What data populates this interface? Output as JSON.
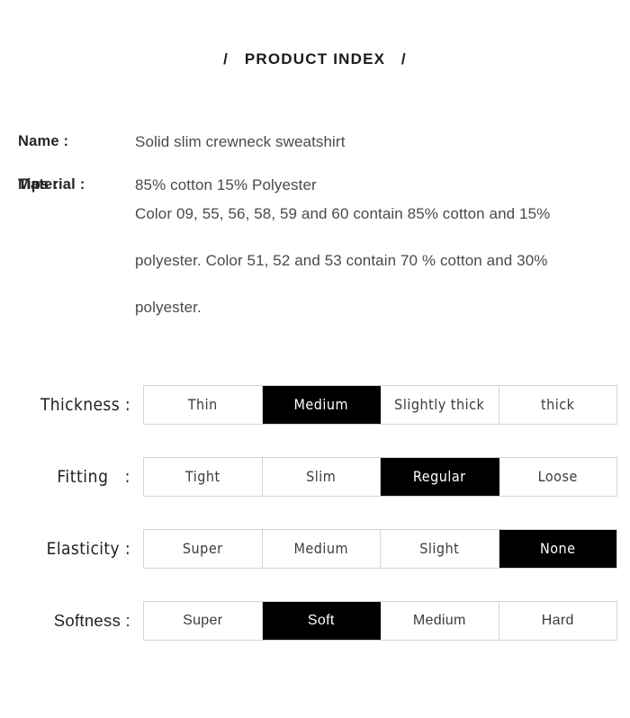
{
  "header": {
    "title": "/   PRODUCT INDEX   /"
  },
  "spec": {
    "rows": [
      {
        "label": "Name :",
        "value": "Solid slim crewneck sweatshirt"
      },
      {
        "label": "Material :",
        "value": "85% cotton 15% Polyester"
      },
      {
        "label": "Tips :",
        "value": "Color 09, 55, 56, 58, 59 and 60 contain 85% cotton and 15% polyester. Color 51, 52 and 53 contain 70 % cotton and 30% polyester."
      }
    ]
  },
  "attributes": {
    "rows": [
      {
        "label": "Thickness :",
        "options": [
          {
            "label": "Thin",
            "selected": false
          },
          {
            "label": "Medium",
            "selected": true
          },
          {
            "label": "Slightly thick",
            "selected": false
          },
          {
            "label": "thick",
            "selected": false
          }
        ]
      },
      {
        "label": "Fitting   :",
        "options": [
          {
            "label": "Tight",
            "selected": false
          },
          {
            "label": "Slim",
            "selected": false
          },
          {
            "label": "Regular",
            "selected": true
          },
          {
            "label": "Loose",
            "selected": false
          }
        ]
      },
      {
        "label": "Elasticity :",
        "options": [
          {
            "label": "Super",
            "selected": false
          },
          {
            "label": "Medium",
            "selected": false
          },
          {
            "label": "Slight",
            "selected": false
          },
          {
            "label": "None",
            "selected": true
          }
        ]
      },
      {
        "label": "Softness :",
        "options": [
          {
            "label": "Super",
            "selected": false
          },
          {
            "label": "Soft",
            "selected": true
          },
          {
            "label": "Medium",
            "selected": false
          },
          {
            "label": "Hard",
            "selected": false
          }
        ]
      }
    ]
  },
  "colors": {
    "selected_background": "#000000",
    "selected_text": "#ffffff",
    "cell_border": "#d4d4d4",
    "page_background": "#ffffff",
    "label_text": "#1f1f1f",
    "value_text": "#4a4a4a"
  }
}
